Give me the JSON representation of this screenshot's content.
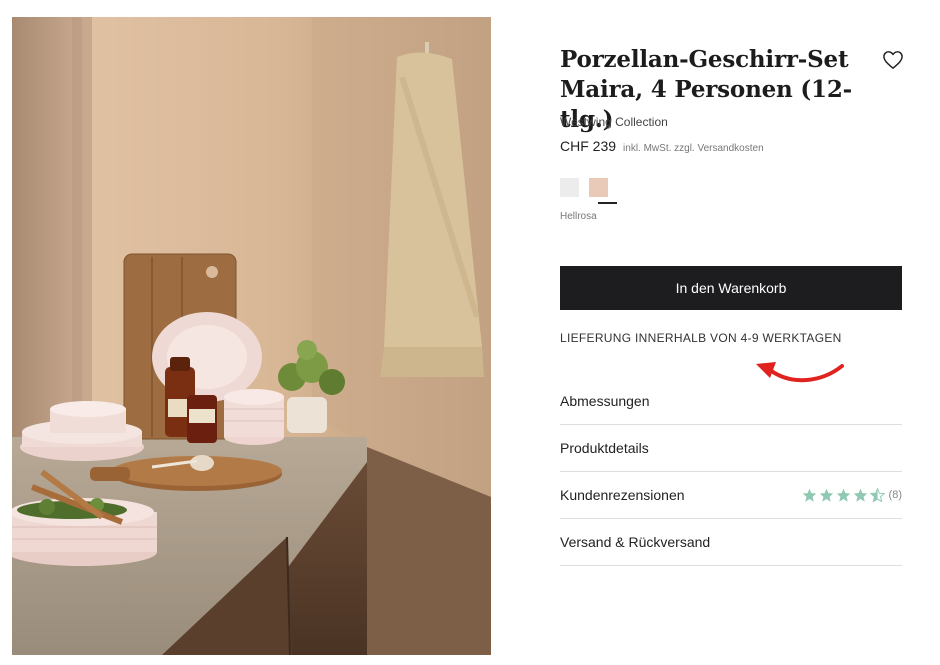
{
  "product": {
    "title": "Porzellan-Geschirr-Set Maira, 4 Personen (12-tlg.)",
    "brand": "Westwing Collection",
    "price": "CHF 239",
    "price_note": "inkl. MwSt. zzgl. Versandkosten",
    "selected_color": "Hellrosa",
    "swatch_colors": [
      "#ececec",
      "#e9c9b8"
    ]
  },
  "actions": {
    "add_to_cart": "In den Warenkorb"
  },
  "delivery": {
    "text": "LIEFERUNG INNERHALB VON 4-9 WERKTAGEN"
  },
  "accordion": [
    {
      "label": "Abmessungen"
    },
    {
      "label": "Produktdetails"
    },
    {
      "label": "Kundenrezensionen",
      "rating": 4.5,
      "review_count": "(8)"
    },
    {
      "label": "Versand & Rückversand"
    }
  ],
  "colors": {
    "button_bg": "#1d1d1f",
    "star": "#8fc9b2",
    "arrow": "#e0231f"
  },
  "icons": {
    "wishlist": "heart-outline-icon",
    "annotation": "red-curved-arrow-icon"
  }
}
